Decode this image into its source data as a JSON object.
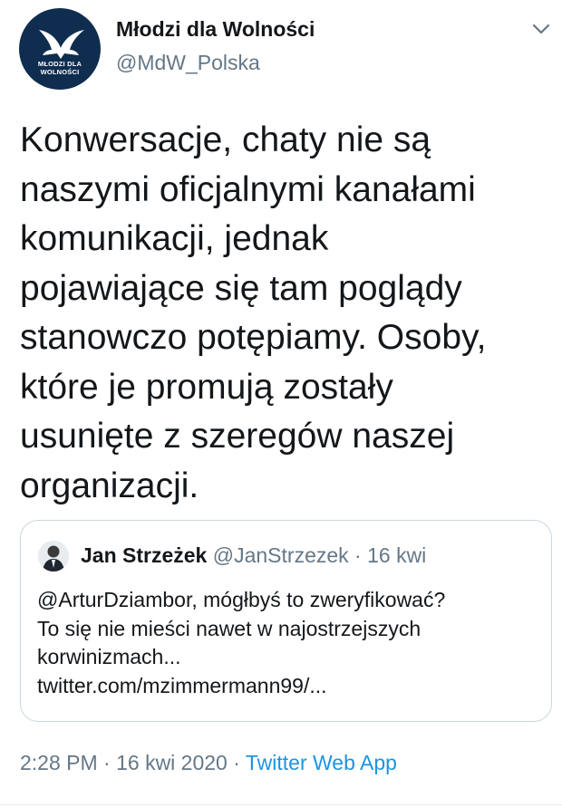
{
  "author": {
    "display_name": "Młodzi dla Wolności",
    "handle": "@MdW_Polska",
    "avatar_label_line1": "MŁODZI DLA",
    "avatar_label_line2": "WOLNOŚCI",
    "avatar_bg_color": "#0f2d4f"
  },
  "tweet": {
    "text": "Konwersacje, chaty nie są\nnaszymi oficjalnymi kanałami\nkomunikacji, jednak\npojawiające się tam poglądy\nstanowczo potępiamy. Osoby,\nktóre je promują zostały\nusunięte z szeregów naszej\norganizacji."
  },
  "quoted_tweet": {
    "display_name": "Jan Strzeżek",
    "handle_and_date": "@JanStrzezek · 16 kwi",
    "lines": [
      "@ArturDziambor, mógłbyś to zweryfikować?",
      "To się nie mieści nawet w najostrzejszych",
      "korwinizmach...",
      "twitter.com/mzimmermann99/..."
    ]
  },
  "footer": {
    "time_date": "2:28 PM · 16 kwi 2020 · ",
    "source": "Twitter Web App",
    "source_color": "#1b95e0"
  },
  "icons": {
    "menu": "chevron-down-icon",
    "avatar_logo": "bird-icon"
  }
}
